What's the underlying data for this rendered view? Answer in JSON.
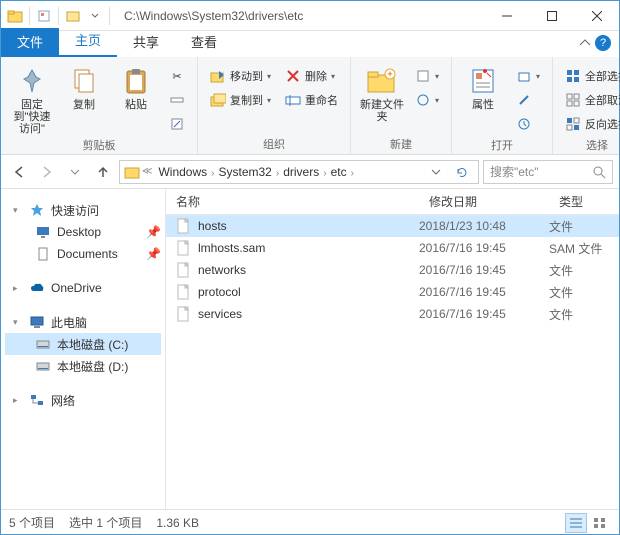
{
  "title_path": "C:\\Windows\\System32\\drivers\\etc",
  "tabs": {
    "file": "文件",
    "home": "主页",
    "share": "共享",
    "view": "查看"
  },
  "ribbon": {
    "clipboard": {
      "label": "剪贴板",
      "pin": "固定到\"快速访问\"",
      "copy": "复制",
      "paste": "粘贴"
    },
    "organize": {
      "label": "组织",
      "moveto": "移动到",
      "copyto": "复制到",
      "delete": "删除",
      "rename": "重命名"
    },
    "new": {
      "label": "新建",
      "folder": "新建文件夹"
    },
    "open": {
      "label": "打开",
      "props": "属性"
    },
    "select": {
      "label": "选择",
      "all": "全部选择",
      "none": "全部取消",
      "invert": "反向选择"
    }
  },
  "breadcrumb": [
    "Windows",
    "System32",
    "drivers",
    "etc"
  ],
  "search_placeholder": "搜索\"etc\"",
  "tree": {
    "quick": "快速访问",
    "desktop": "Desktop",
    "documents": "Documents",
    "onedrive": "OneDrive",
    "thispc": "此电脑",
    "drive_c": "本地磁盘 (C:)",
    "drive_d": "本地磁盘 (D:)",
    "network": "网络"
  },
  "columns": {
    "name": "名称",
    "date": "修改日期",
    "type": "类型"
  },
  "files": [
    {
      "name": "hosts",
      "date": "2018/1/23 10:48",
      "type": "文件",
      "selected": true
    },
    {
      "name": "lmhosts.sam",
      "date": "2016/7/16 19:45",
      "type": "SAM 文件",
      "selected": false
    },
    {
      "name": "networks",
      "date": "2016/7/16 19:45",
      "type": "文件",
      "selected": false
    },
    {
      "name": "protocol",
      "date": "2016/7/16 19:45",
      "type": "文件",
      "selected": false
    },
    {
      "name": "services",
      "date": "2016/7/16 19:45",
      "type": "文件",
      "selected": false
    }
  ],
  "status": {
    "count": "5 个项目",
    "selected": "选中 1 个项目",
    "size": "1.36 KB"
  }
}
